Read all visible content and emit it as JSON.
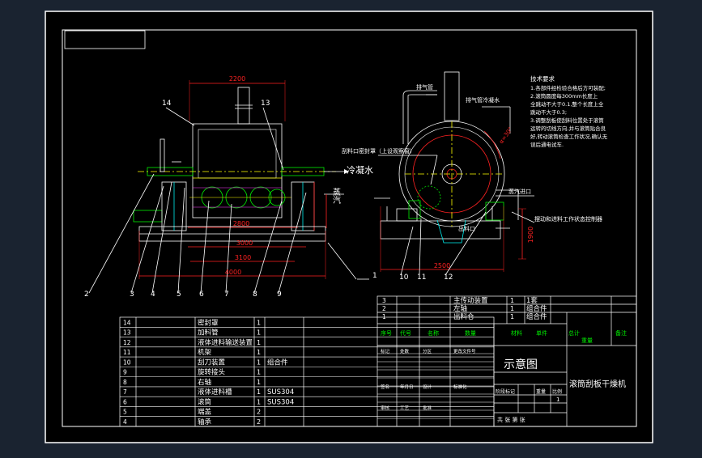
{
  "window": {
    "bg": "#1a2330",
    "frame": "#ffffff",
    "sheet_bg": "#000000"
  },
  "colors": {
    "white": "#ffffff",
    "yellow": "#ffff00",
    "red": "#ff2020",
    "green": "#00e000",
    "cyan": "#00e5ee",
    "magenta": "#ff40ff",
    "dash": "#5a5acf"
  },
  "front_view": {
    "dims": {
      "top": "2200",
      "mid1": "2800",
      "mid2": "3000",
      "mid3": "3100",
      "bottom": "4000"
    },
    "labels": {
      "p14": "14",
      "p13": "13"
    },
    "annotations": {
      "condensate": "冷凝水",
      "steam": "蒸汽"
    },
    "balloons": [
      "2",
      "3",
      "4",
      "5",
      "6",
      "7",
      "8",
      "9",
      "1"
    ]
  },
  "side_view": {
    "labels": {
      "exhaust_pipe": "排气管",
      "exhaust_cooling": "排气管冷凝水",
      "sealing_cover": "刮料口密封罩（上设观察窗）",
      "steam_inlet": "蒸汽进口",
      "outlet": "出料口",
      "bearing_note": "摆动和进料工作状态控制器",
      "angle": "α=30°",
      "dim_bottom": "2500",
      "dim_right": "1900"
    },
    "balloons": [
      "10",
      "11",
      "12"
    ]
  },
  "tech_notes": {
    "title": "技术要求",
    "lines": [
      "1.各部件经检验合格后方可装配;",
      "2.滚筒圆度每300mm长度上",
      "   全跳动不大于0.1,整个长度上全",
      "   跳动不大于0.3;",
      "3.调整刮板使刮料位置处于滚筒",
      "   运转的切线方向,并与滚筒贴合良",
      "   好,转动滚筒检查工作状况,确认无",
      "   误后通电试车."
    ]
  },
  "bom_left": [
    {
      "no": "14",
      "name": "密封罩",
      "qty": "1",
      "mat": ""
    },
    {
      "no": "13",
      "name": "加料管",
      "qty": "1",
      "mat": ""
    },
    {
      "no": "12",
      "name": "液体进料输送装置",
      "qty": "1",
      "mat": ""
    },
    {
      "no": "11",
      "name": "机架",
      "qty": "1",
      "mat": ""
    },
    {
      "no": "10",
      "name": "刮刀装置",
      "qty": "1",
      "mat": "组合件"
    },
    {
      "no": "9",
      "name": "旋转接头",
      "qty": "1",
      "mat": ""
    },
    {
      "no": "8",
      "name": "右轴",
      "qty": "1",
      "mat": ""
    },
    {
      "no": "7",
      "name": "液体进料槽",
      "qty": "1",
      "mat": "SUS304"
    },
    {
      "no": "6",
      "name": "滚筒",
      "qty": "1",
      "mat": "SUS304"
    },
    {
      "no": "5",
      "name": "端盖",
      "qty": "2",
      "mat": ""
    },
    {
      "no": "4",
      "name": "轴承",
      "qty": "2",
      "mat": ""
    }
  ],
  "bom_right": [
    {
      "no": "3",
      "name": "主传动装置",
      "qty": "1",
      "mat": "1套"
    },
    {
      "no": "2",
      "name": "左轴",
      "qty": "1",
      "mat": "组合件"
    },
    {
      "no": "1",
      "name": "出料仓",
      "qty": "1",
      "mat": "组合件"
    }
  ],
  "bom_header": [
    "序号",
    "代号",
    "名称",
    "数量",
    "材料",
    "单件",
    "总计",
    "备注"
  ],
  "bom_header_sub": [
    "重量"
  ],
  "title_block": {
    "sketch": "示意图",
    "machine": "滚筒刮板干燥机",
    "stage_mark": "阶段标记",
    "weight": "重量",
    "scale": "比例",
    "scale_value": "1",
    "sheet_info": "共 张 第 张",
    "rows": [
      "标记",
      "处数",
      "分区",
      "更改文件号",
      "签名",
      "年月日",
      "设计",
      "标准化",
      "审核",
      "工艺",
      "批准"
    ]
  }
}
